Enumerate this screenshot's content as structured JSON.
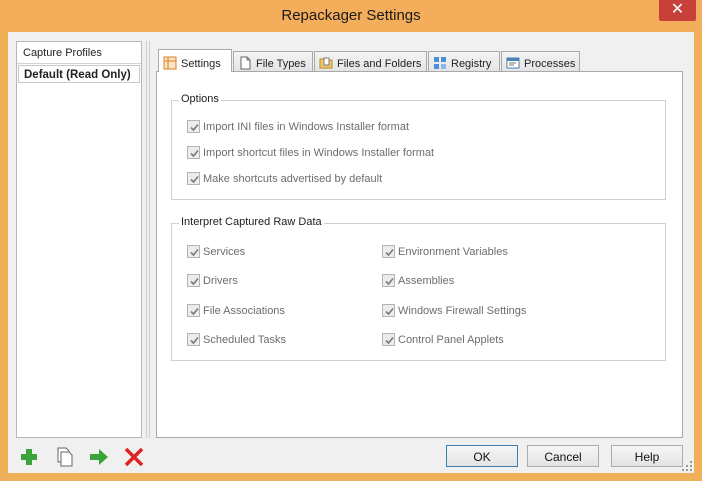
{
  "window": {
    "title": "Repackager Settings",
    "close_glyph": "✕",
    "title_color": "#f3ad5b"
  },
  "left": {
    "header": "Capture Profiles",
    "selected_profile": "Default (Read Only)"
  },
  "tabs": [
    {
      "label": "Settings",
      "icon": "settings-grid-icon"
    },
    {
      "label": "File Types",
      "icon": "file-icon"
    },
    {
      "label": "Files and Folders",
      "icon": "files-folders-icon"
    },
    {
      "label": "Registry",
      "icon": "registry-icon"
    },
    {
      "label": "Processes",
      "icon": "processes-icon"
    }
  ],
  "options": {
    "title": "Options",
    "items": [
      {
        "label": "Import INI files in Windows Installer format",
        "checked": true
      },
      {
        "label": "Import shortcut files in Windows Installer format",
        "checked": true
      },
      {
        "label": "Make shortcuts advertised by default",
        "checked": true
      }
    ]
  },
  "interpret": {
    "title": "Interpret Captured Raw Data",
    "left": [
      {
        "label": "Services",
        "checked": true
      },
      {
        "label": "Drivers",
        "checked": true
      },
      {
        "label": "File Associations",
        "checked": true
      },
      {
        "label": "Scheduled Tasks",
        "checked": true
      }
    ],
    "right": [
      {
        "label": "Environment Variables",
        "checked": true
      },
      {
        "label": "Assemblies",
        "checked": true
      },
      {
        "label": "Windows Firewall Settings",
        "checked": true
      },
      {
        "label": "Control Panel Applets",
        "checked": true
      }
    ]
  },
  "toolbar": {
    "add_icon": "add-icon",
    "copy_icon": "copy-icon",
    "export_icon": "arrow-right-icon",
    "delete_icon": "delete-icon"
  },
  "buttons": {
    "ok": "OK",
    "cancel": "Cancel",
    "help": "Help"
  }
}
